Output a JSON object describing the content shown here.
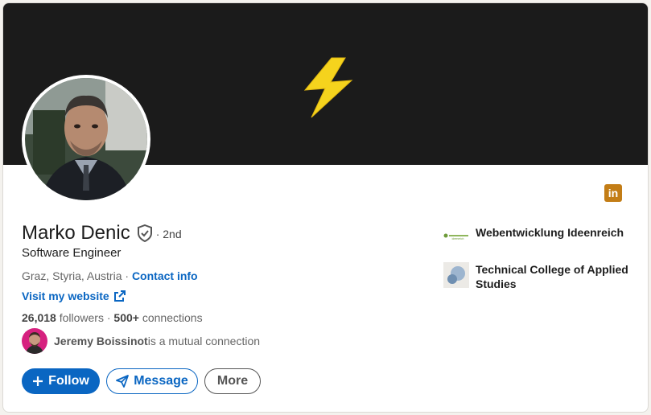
{
  "profile": {
    "name": "Marko Denic",
    "degree": "· 2nd",
    "headline": "Software Engineer",
    "location": "Graz, Styria, Austria",
    "separator": " · ",
    "contact_info": "Contact info",
    "website": "Visit my website",
    "followers_count": "26,018",
    "followers_label": " followers ",
    "connections_sep": " · ",
    "connections": "500+",
    "connections_label": " connections"
  },
  "mutual": {
    "name": "Jeremy Boissinot",
    "text": " is a mutual connection"
  },
  "actions": {
    "follow": "Follow",
    "follow_icon": "plus-icon",
    "message": "Message",
    "message_icon": "send-icon",
    "more": "More"
  },
  "orgs": [
    {
      "name": "Webentwicklung Ideenreich",
      "logo": "ideenreich-logo",
      "logo_text": "ideenreich"
    },
    {
      "name": "Technical College of Applied Studies",
      "logo": "college-logo"
    }
  ],
  "badge": {
    "text": "in",
    "icon": "linkedin-icon"
  },
  "colors": {
    "banner": "#1b1b1b",
    "bolt": "#f5d31d",
    "accent": "#0a66c2",
    "badge": "#c37d16"
  }
}
